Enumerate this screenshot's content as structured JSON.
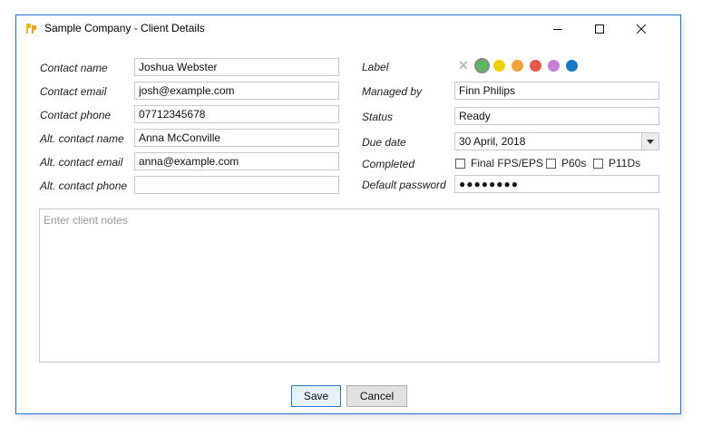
{
  "window": {
    "title": "Sample Company - Client Details"
  },
  "left_fields": [
    {
      "label": "Contact name",
      "value": "Joshua Webster"
    },
    {
      "label": "Contact email",
      "value": "josh@example.com"
    },
    {
      "label": "Contact phone",
      "value": "07712345678"
    },
    {
      "label": "Alt. contact name",
      "value": "Anna McConville"
    },
    {
      "label": "Alt. contact email",
      "value": "anna@example.com"
    },
    {
      "label": "Alt. contact phone",
      "value": ""
    }
  ],
  "label_row": {
    "label": "Label",
    "colors": [
      "#5cb85c",
      "#f2d200",
      "#f0a33a",
      "#e8584a",
      "#c77ddb",
      "#1679c8"
    ],
    "selected": "#5cb85c",
    "clear_icon": "close-icon"
  },
  "managed_by": {
    "label": "Managed by",
    "value": "Finn Philips"
  },
  "status": {
    "label": "Status",
    "value": "Ready"
  },
  "due_date": {
    "label": "Due date",
    "value": "30 April, 2018"
  },
  "completed": {
    "label": "Completed",
    "options": [
      {
        "label": "Final FPS/EPS",
        "checked": false
      },
      {
        "label": "P60s",
        "checked": false
      },
      {
        "label": "P11Ds",
        "checked": false
      }
    ]
  },
  "default_password": {
    "label": "Default password",
    "value": "●●●●●●●●"
  },
  "notes": {
    "placeholder": "Enter client notes"
  },
  "buttons": {
    "save": "Save",
    "cancel": "Cancel"
  }
}
